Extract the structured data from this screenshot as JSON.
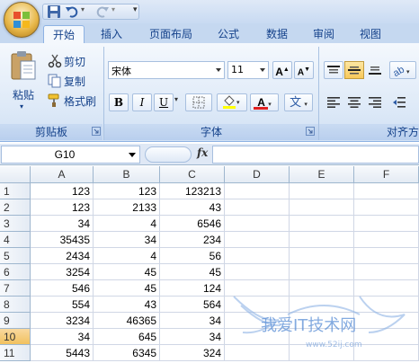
{
  "quick_access": {
    "icons": [
      "save-icon",
      "undo-icon",
      "redo-icon",
      "customize-icon"
    ]
  },
  "tabs": [
    {
      "label": "开始",
      "active": true
    },
    {
      "label": "插入"
    },
    {
      "label": "页面布局"
    },
    {
      "label": "公式"
    },
    {
      "label": "数据"
    },
    {
      "label": "审阅"
    },
    {
      "label": "视图"
    }
  ],
  "clipboard": {
    "paste_label": "粘贴",
    "cut_label": "剪切",
    "copy_label": "复制",
    "format_painter_label": "格式刷",
    "group_label": "剪贴板"
  },
  "font": {
    "name": "宋体",
    "size": "11",
    "grow_label": "A",
    "shrink_label": "A",
    "bold": "B",
    "italic": "I",
    "underline": "U",
    "font_color_label": "A",
    "phonetic_label": "文",
    "group_label": "字体"
  },
  "alignment": {
    "group_label": "对齐方"
  },
  "formula_bar": {
    "name_box": "G10",
    "fx": "fx",
    "formula": ""
  },
  "sheet": {
    "columns": [
      "A",
      "B",
      "C",
      "D",
      "E",
      "F"
    ],
    "selected_row": 10,
    "rows": [
      {
        "n": "1",
        "cells": [
          "123",
          "123",
          "123213"
        ]
      },
      {
        "n": "2",
        "cells": [
          "123",
          "2133",
          "43"
        ]
      },
      {
        "n": "3",
        "cells": [
          "34",
          "4",
          "6546"
        ]
      },
      {
        "n": "4",
        "cells": [
          "35435",
          "34",
          "234"
        ]
      },
      {
        "n": "5",
        "cells": [
          "2434",
          "4",
          "56"
        ]
      },
      {
        "n": "6",
        "cells": [
          "3254",
          "45",
          "45"
        ]
      },
      {
        "n": "7",
        "cells": [
          "546",
          "45",
          "124"
        ]
      },
      {
        "n": "8",
        "cells": [
          "554",
          "43",
          "564"
        ]
      },
      {
        "n": "9",
        "cells": [
          "3234",
          "46365",
          "34"
        ]
      },
      {
        "n": "10",
        "cells": [
          "34",
          "645",
          "34"
        ]
      },
      {
        "n": "11",
        "cells": [
          "5443",
          "6345",
          "324"
        ]
      }
    ]
  },
  "watermark": {
    "text": "我爱IT技术网",
    "url": "www.52ij.com"
  },
  "colors": {
    "accent": "#15428b",
    "ribbon": "#dbe6f5",
    "selection": "#f1c15f"
  }
}
